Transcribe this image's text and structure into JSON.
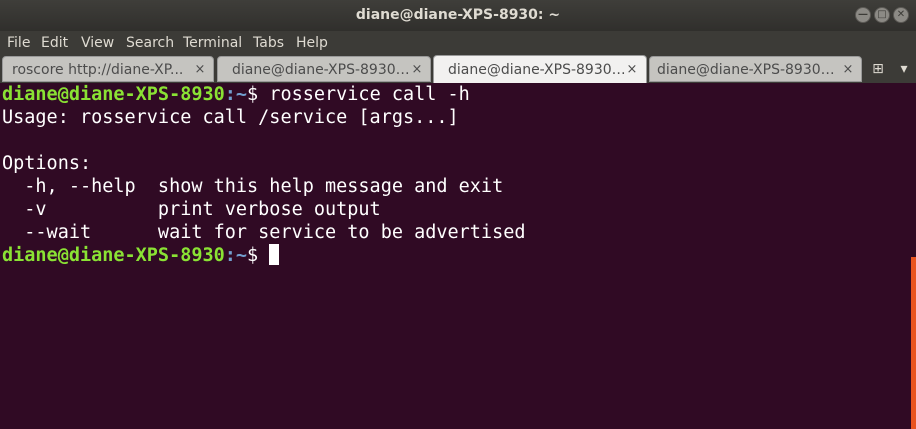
{
  "window": {
    "title": "diane@diane-XPS-8930: ~",
    "controls": {
      "minimize_icon": "—",
      "maximize_icon": "□",
      "close_icon": "✕"
    }
  },
  "menu": [
    "File",
    "Edit",
    "View",
    "Search",
    "Terminal",
    "Tabs",
    "Help"
  ],
  "tabs": [
    {
      "label": "roscore http://diane-XP...",
      "close": "×",
      "active": false
    },
    {
      "label": "diane@diane-XPS-8930: ~",
      "close": "×",
      "active": false
    },
    {
      "label": "diane@diane-XPS-8930: ~",
      "close": "×",
      "active": true
    },
    {
      "label": "diane@diane-XPS-8930: ...",
      "close": "×",
      "active": false
    }
  ],
  "tab_buttons": {
    "new_tab_icon": "⊞",
    "dropdown_icon": "▾"
  },
  "terminal": {
    "prompt_user": "diane@diane-XPS-8930",
    "prompt_path": ":~",
    "prompt_symbol": "$ ",
    "command": "rosservice call -h",
    "output": [
      "Usage: rosservice call /service [args...]",
      "",
      "Options:",
      "  -h, --help  show this help message and exit",
      "  -v          print verbose output",
      "  --wait      wait for service to be advertised"
    ]
  },
  "colors": {
    "background": "#300a24",
    "prompt_user": "#8ae234",
    "prompt_path": "#729fcf",
    "scrollbar": "#e95420"
  }
}
